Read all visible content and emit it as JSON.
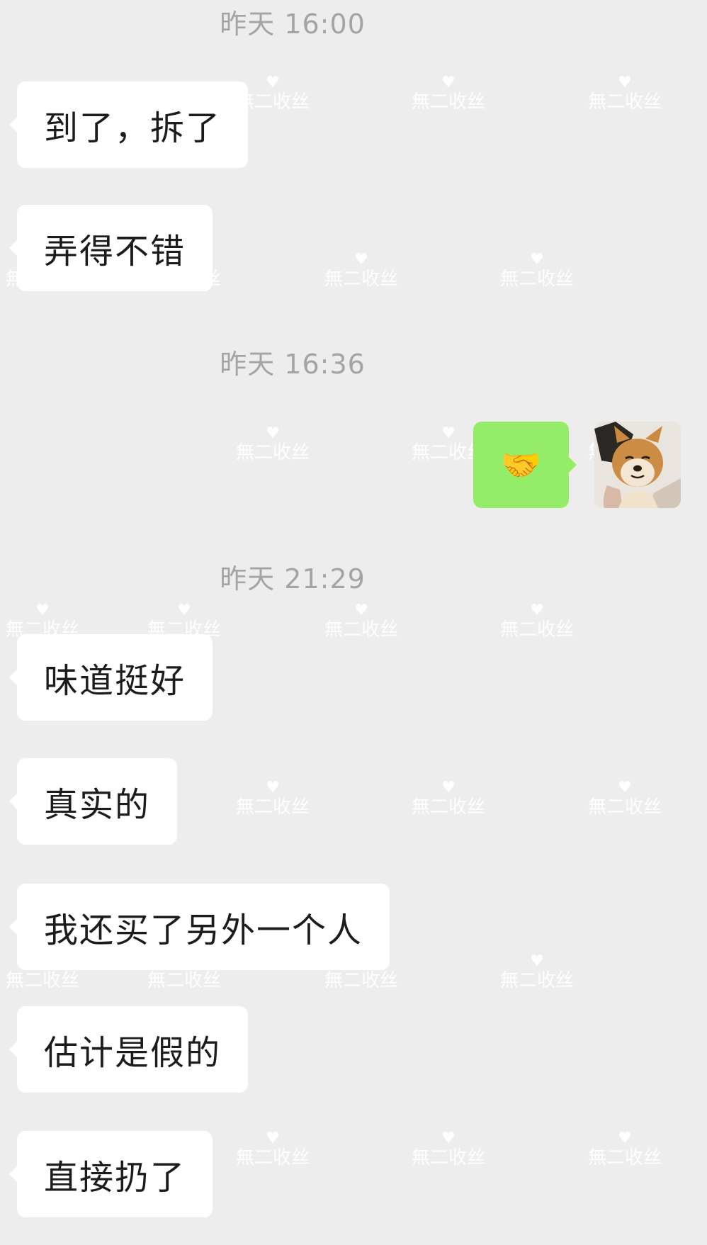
{
  "chat": {
    "timestamps": [
      "昨天 16:00",
      "昨天 16:36",
      "昨天 21:29"
    ],
    "messages": [
      {
        "text": "到了，拆了"
      },
      {
        "text": "弄得不错"
      },
      {
        "emoji": "🤝"
      },
      {
        "text": "味道挺好"
      },
      {
        "text": "真实的"
      },
      {
        "text": "我还买了另外一个人"
      },
      {
        "text": "估计是假的"
      },
      {
        "text": "直接扔了"
      }
    ]
  },
  "watermark": {
    "text": "無二收丝",
    "heart": "♥"
  },
  "colors": {
    "background": "#ededed",
    "incoming_bubble": "#ffffff",
    "outgoing_bubble": "#95ec69",
    "timestamp_text": "#a4a4a4"
  },
  "icons": {
    "outgoing_message": "handshake-emoji",
    "avatar": "shiba-dog-avatar"
  }
}
